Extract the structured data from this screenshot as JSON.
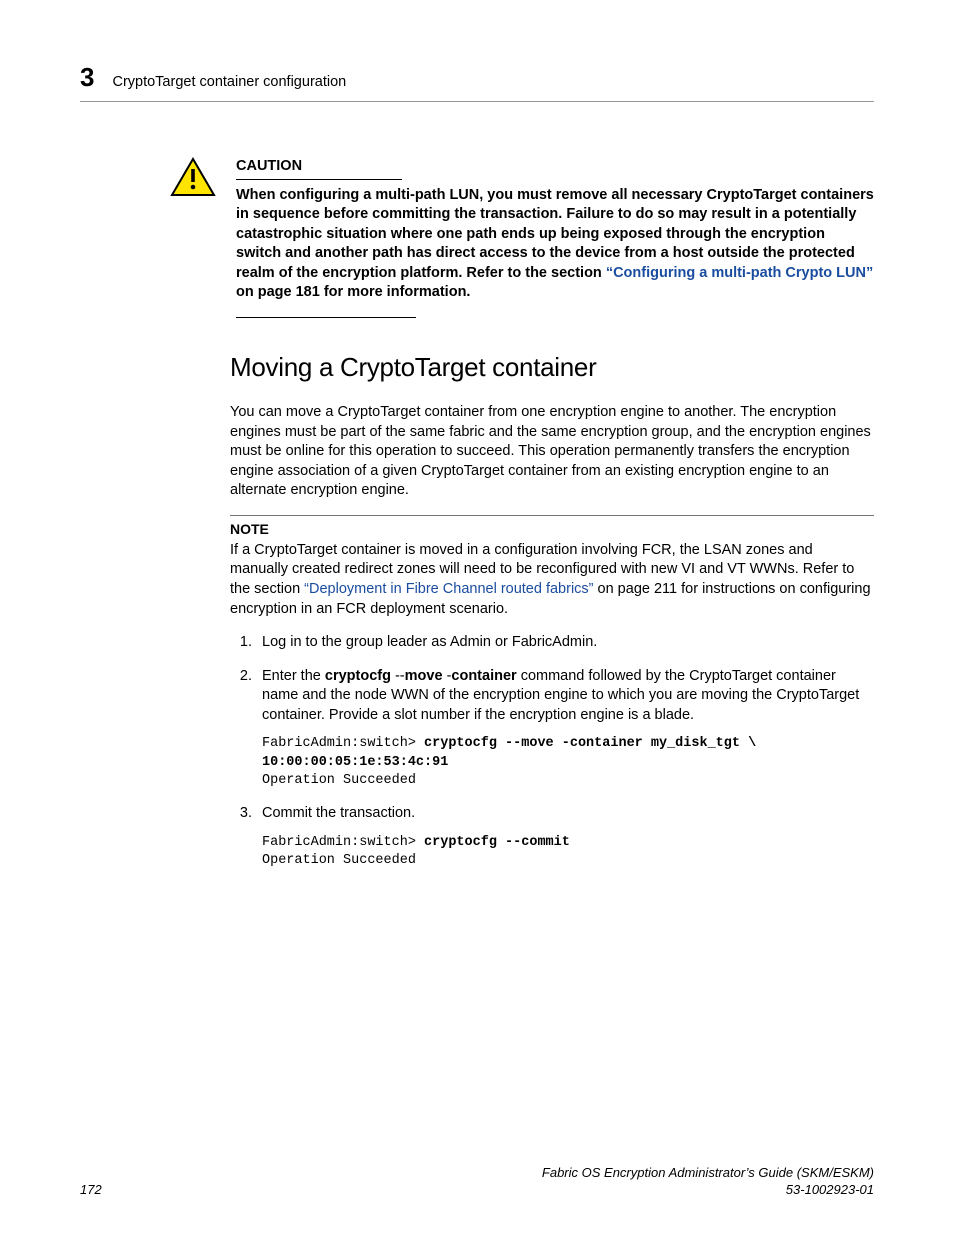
{
  "header": {
    "chapter_number": "3",
    "title": "CryptoTarget container configuration"
  },
  "caution": {
    "label": "CAUTION",
    "body_prefix": "When configuring a multi-path LUN, you must remove all necessary CryptoTarget containers in sequence before committing the transaction. Failure to do so may result in a potentially catastrophic situation where one path ends up being exposed through the encryption switch and another path has direct access to the device from a host outside the protected realm of the encryption platform. Refer to the section ",
    "link_text": "“Configuring a multi-path Crypto LUN”",
    "body_mid": " on page 181 for more information."
  },
  "section_heading": "Moving a CryptoTarget container",
  "intro": "You can move a CryptoTarget container from one encryption engine to another. The encryption engines must be part of the same fabric and the same encryption group, and the encryption engines must be online for this operation to succeed. This operation permanently transfers the encryption engine association of a given CryptoTarget container from an existing encryption engine to an alternate encryption engine.",
  "note": {
    "label": "NOTE",
    "prefix": "If a CryptoTarget container is moved in a configuration involving FCR, the LSAN zones and manually created redirect zones will need to be reconfigured with new VI and VT WWNs. Refer to the section ",
    "link_text": "“Deployment in Fibre Channel routed fabrics”",
    "suffix": " on page 211 for instructions on configuring encryption in an FCR deployment scenario."
  },
  "steps": {
    "s1": "Log in to the group leader as Admin or FabricAdmin.",
    "s2_a": "Enter the ",
    "s2_cmd1": "cryptocfg ",
    "s2_cmd2": "--",
    "s2_cmd3": "move ",
    "s2_cmd4": "-",
    "s2_cmd5": "container",
    "s2_b": " command followed by the CryptoTarget container name and the node WWN of the encryption engine to which you are moving the CryptoTarget container. Provide a slot number if the encryption engine is a blade.",
    "s3": "Commit the transaction."
  },
  "code1": {
    "prompt": "FabricAdmin:switch> ",
    "bold1": "cryptocfg --move -container my_disk_tgt \\",
    "bold2": "10:00:00:05:1e:53:4c:91",
    "result": "Operation Succeeded"
  },
  "code2": {
    "prompt": "FabricAdmin:switch> ",
    "bold": "cryptocfg --commit",
    "result": "Operation Succeeded"
  },
  "footer": {
    "page": "172",
    "book": "Fabric OS Encryption Administrator’s Guide (SKM/ESKM)",
    "docnum": "53-1002923-01"
  }
}
